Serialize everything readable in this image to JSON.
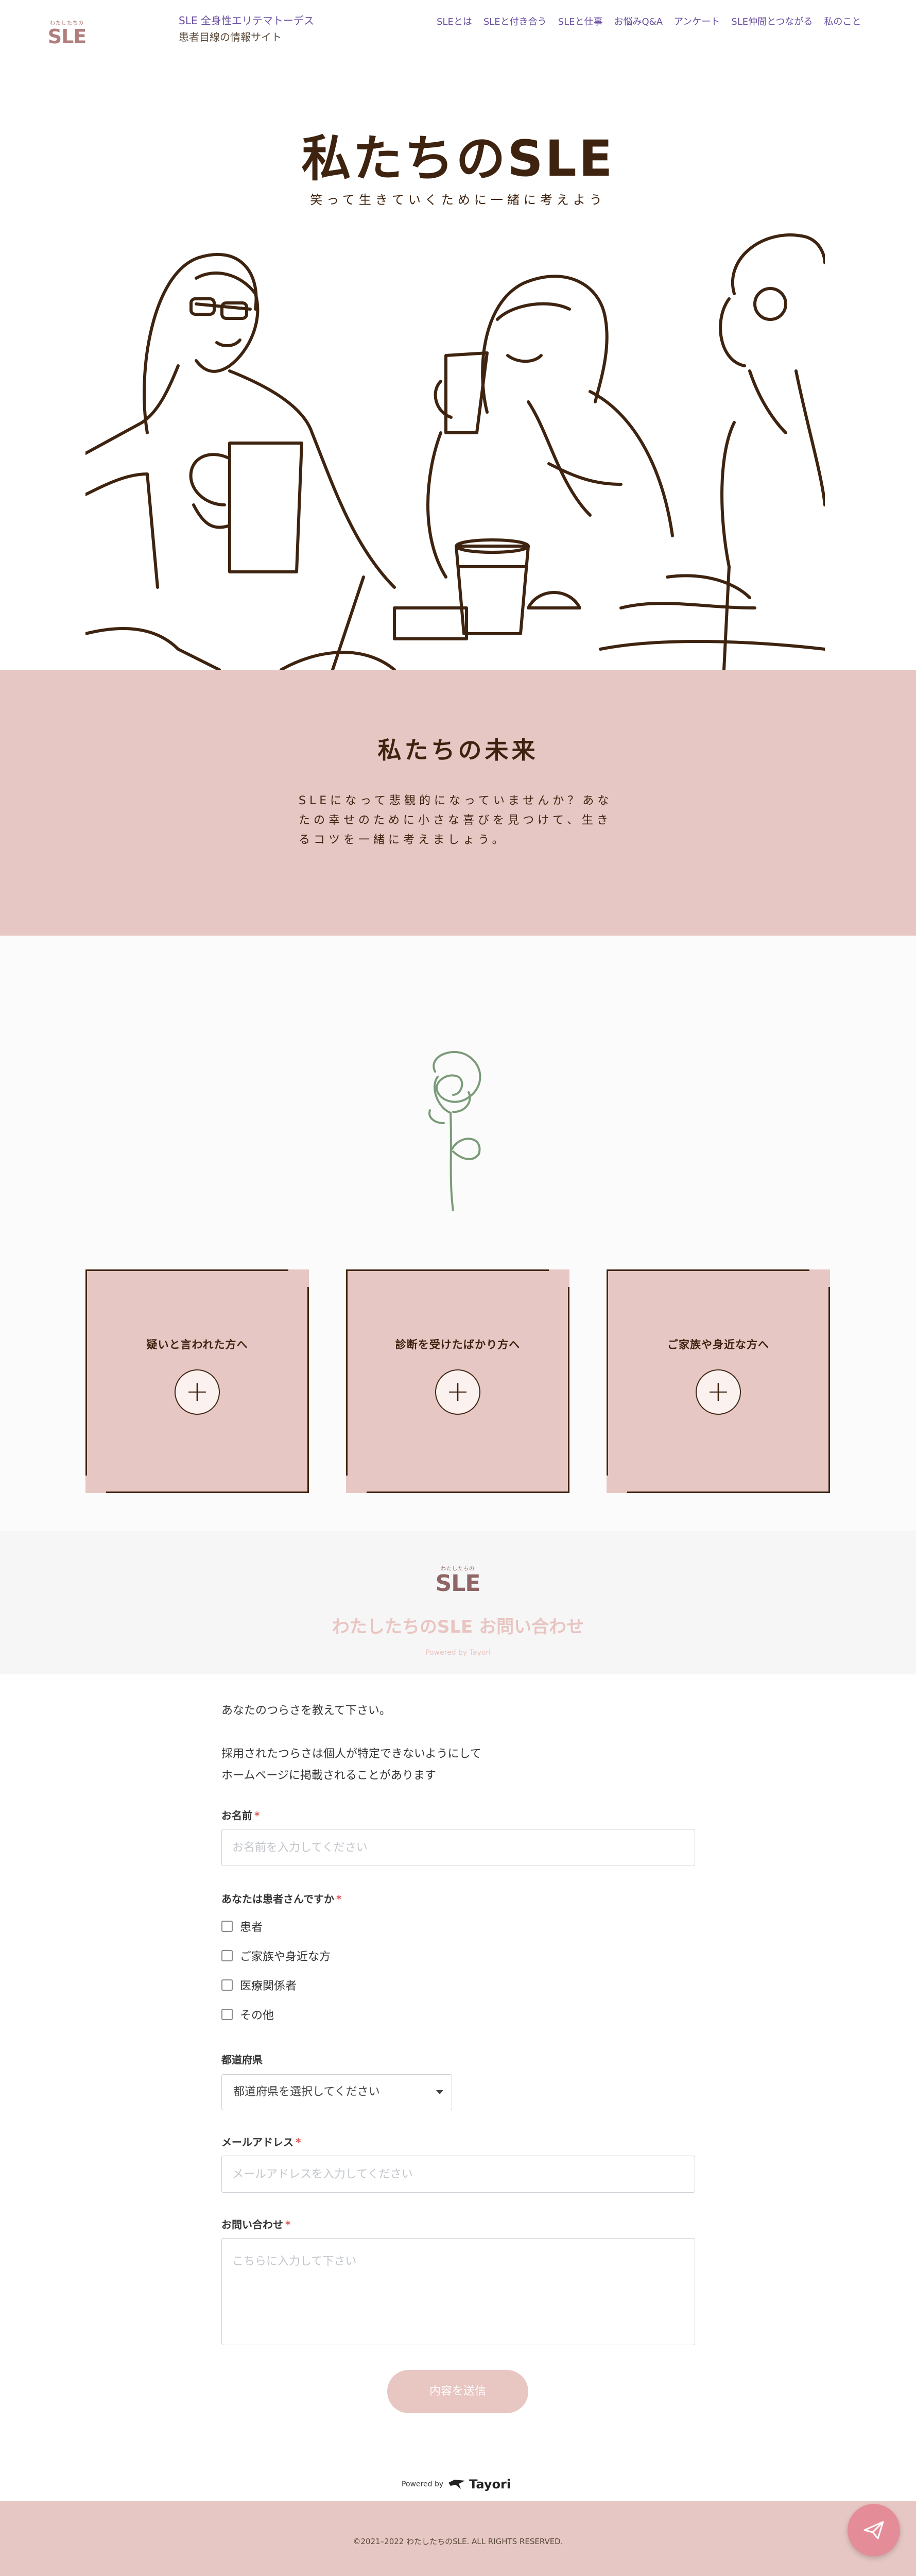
{
  "header": {
    "logo_sub": "わたしたちの",
    "logo_main": "SLE",
    "site_line1": "SLE 全身性エリテマトーデス",
    "site_line2": "患者目線の情報サイト",
    "nav": [
      "SLEとは",
      "SLEと付き合う",
      "SLEと仕事",
      "お悩みQ&A",
      "アンケート",
      "SLE仲間とつながる",
      "私のこと"
    ]
  },
  "hero": {
    "title": "私たちのSLE",
    "subtitle": "笑って生きていくために一緒に考えよう"
  },
  "future": {
    "title": "私たちの未来",
    "text": "SLEになって悲観的になっていませんか？あなたの幸せのために小さな喜びを見つけて、生きるコツを一緒に考えましょう。"
  },
  "cards": [
    {
      "label": "疑いと言われた方へ"
    },
    {
      "label": "診断を受けたばかり方へ"
    },
    {
      "label": "ご家族や身近な方へ"
    }
  ],
  "contact": {
    "logo_sub": "わたしたちの",
    "logo_main": "SLE",
    "title": "わたしたちのSLE お問い合わせ",
    "powered_small": "Powered by Tayori"
  },
  "form": {
    "intro1": "あなたのつらさを教えて下さい。",
    "intro2": "採用されたつらさは個人が特定できないようにして",
    "intro3": "ホームページに掲載されることがあります",
    "name_label": "お名前",
    "name_placeholder": "お名前を入力してください",
    "patient_label": "あなたは患者さんですか",
    "patient_options": [
      "患者",
      "ご家族や身近な方",
      "医療関係者",
      "その他"
    ],
    "pref_label": "都道府県",
    "pref_selected": "都道府県を選択してください",
    "email_label": "メールアドレス",
    "email_placeholder": "メールアドレスを入力してください",
    "inquiry_label": "お問い合わせ",
    "inquiry_placeholder": "こちらに入力して下さい",
    "required_mark": "*",
    "submit_label": "内容を送信"
  },
  "powered": {
    "prefix": "Powered by",
    "brand": "Tayori"
  },
  "footer": {
    "copyright": "©2021–2022 わたしたちのSLE. ALL RIGHTS RESERVED."
  },
  "colors": {
    "brown": "#3e2410",
    "pink": "#e6c7c3",
    "purple": "#6a4fa0",
    "fab": "#e48d98",
    "leaf": "#7a9a78"
  },
  "icons": {
    "fab": "paper-plane-icon",
    "card_toggle": "plus-icon",
    "tayori": "bird-logo-icon"
  }
}
